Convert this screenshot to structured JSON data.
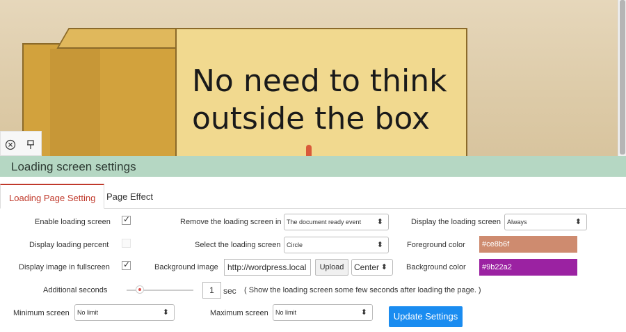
{
  "preview": {
    "image_text_line1": "No need to think",
    "image_text_line2": "outside the box",
    "toolbar": {
      "close_icon": "close-circle-icon",
      "pin_icon": "pin-icon"
    }
  },
  "header": {
    "title": "Loading screen settings"
  },
  "tabs": [
    {
      "label": "Loading Page Setting",
      "active": true
    },
    {
      "label": "Page Effect",
      "active": false
    }
  ],
  "form": {
    "enable_loading_screen": {
      "label": "Enable loading screen",
      "checked": true
    },
    "display_loading_percent": {
      "label": "Display loading percent",
      "checked": false
    },
    "display_image_fullscreen": {
      "label": "Display image in fullscreen",
      "checked": true
    },
    "remove_loading_in": {
      "label": "Remove the loading screen in",
      "value": "The document ready event"
    },
    "select_loading_screen": {
      "label": "Select the loading screen",
      "value": "Circle"
    },
    "background_image": {
      "label": "Background image",
      "value": "http://wordpress.local",
      "upload_label": "Upload",
      "position_value": "Center"
    },
    "display_loading_screen": {
      "label": "Display the loading screen",
      "value": "Always"
    },
    "foreground_color": {
      "label": "Foreground color",
      "value": "#ce8b6f"
    },
    "background_color": {
      "label": "Background color",
      "value": "#9b22a2"
    },
    "additional_seconds": {
      "label": "Additional seconds",
      "value": "1",
      "unit": "sec",
      "help": "( Show the loading screen some few seconds after loading the page. )"
    },
    "minimum_screen": {
      "label": "Minimum screen",
      "value": "No limit"
    },
    "maximum_screen": {
      "label": "Maximum screen",
      "value": "No limit"
    },
    "update_button": "Update Settings"
  }
}
